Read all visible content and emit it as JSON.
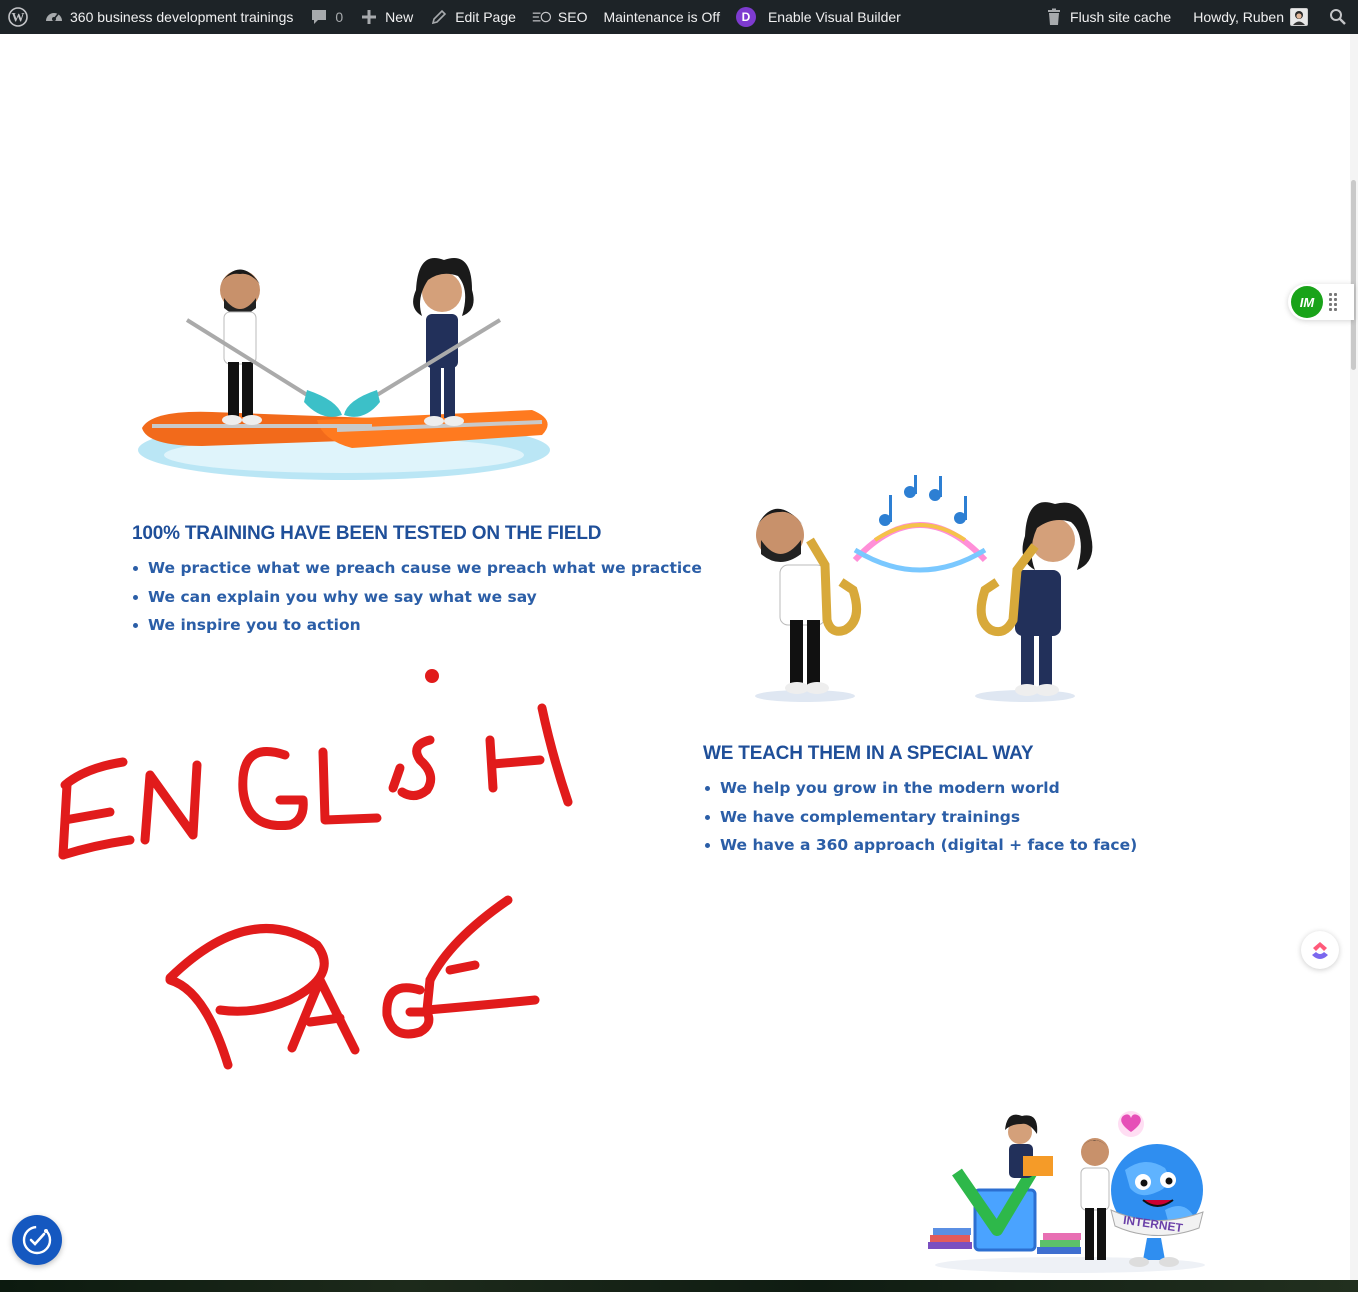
{
  "adminbar": {
    "site_name": "360 business development trainings",
    "comments_count": "0",
    "new_label": "New",
    "edit_label": "Edit Page",
    "seo_label": "SEO",
    "maintenance_label": "Maintenance is Off",
    "divi_letter": "D",
    "visual_builder_label": "Enable Visual Builder",
    "flush_cache_label": "Flush site cache",
    "howdy_label": "Howdy, Ruben"
  },
  "section1": {
    "heading": "100% TRAINING HAVE BEEN TESTED ON THE FIELD",
    "bullets": [
      "We practice what we preach cause we preach what we practice",
      "We can explain you why we say what we say",
      "We inspire you to action"
    ]
  },
  "section2": {
    "heading": "WE TEACH THEM IN A SPECIAL WAY",
    "bullets": [
      "We help you grow in the modern world",
      "We have complementary trainings",
      "We have a 360 approach (digital + face to face)"
    ]
  },
  "illustration": {
    "globe_label": "INTERNET"
  },
  "widgets": {
    "im_logo": "IM"
  },
  "colors": {
    "heading": "#1f4f99",
    "text": "#2b5ea7",
    "adminbar": "#1d2327",
    "scribble": "#e11b1b"
  }
}
